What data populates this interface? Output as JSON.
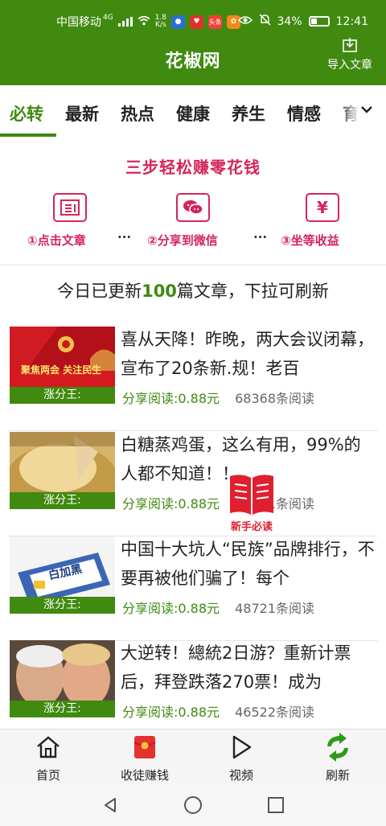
{
  "status_bar": {
    "carrier": "中国移动",
    "network": "4G",
    "speed_value": "1.8",
    "speed_unit": "K/s",
    "app_badge_text": "头条",
    "battery": "34%",
    "time": "12:41"
  },
  "header": {
    "title": "花椒网",
    "import_label": "导入文章"
  },
  "tabs": [
    "必转",
    "最新",
    "热点",
    "健康",
    "养生",
    "情感",
    "育"
  ],
  "active_tab": "必转",
  "promo": {
    "title": "三步轻松赚零花钱",
    "steps": [
      {
        "label": "①点击文章",
        "icon": "article-icon"
      },
      {
        "label": "②分享到微信",
        "icon": "wechat-icon"
      },
      {
        "label": "③坐等收益",
        "icon": "yen-icon"
      }
    ],
    "separator": "···"
  },
  "update_notice": {
    "prefix": "今日已更新",
    "count": "100",
    "suffix": "篇文章，下拉可刷新"
  },
  "articles": [
    {
      "title": "喜从天降！昨晚，两大会议闭幕，宣布了20条新.规！老百",
      "thumb_label": "涨分王:",
      "thumb_text": "聚焦两会 关注民生",
      "earn": "分享阅读:0.88元",
      "reads": "68368条阅读"
    },
    {
      "title": "白糖蒸鸡蛋，这么有用，99%的人都不知道！！",
      "thumb_label": "涨分王:",
      "earn": "分享阅读:0.88元",
      "reads": "38841条阅读"
    },
    {
      "title": "中国十大坑人“民族”品牌排行，不要再被他们骗了！每个",
      "thumb_label": "涨分王:",
      "thumb_text": "白加黑",
      "earn": "分享阅读:0.88元",
      "reads": "48721条阅读"
    },
    {
      "title": "大逆转！總統2日游？重新计票后，拜登跌落270票！成为",
      "thumb_label": "涨分王:",
      "earn": "分享阅读:0.88元",
      "reads": "46522条阅读"
    }
  ],
  "floating_badge": {
    "label": "新手必读"
  },
  "bottom_nav": [
    {
      "label": "首页",
      "icon": "home-icon"
    },
    {
      "label": "收徒赚钱",
      "icon": "red-envelope-icon"
    },
    {
      "label": "视频",
      "icon": "play-icon"
    },
    {
      "label": "刷新",
      "icon": "refresh-icon"
    }
  ],
  "colors": {
    "brand_green": "#3f8a0f",
    "promo_red": "#d6245a",
    "badge_red": "#e0202f"
  }
}
